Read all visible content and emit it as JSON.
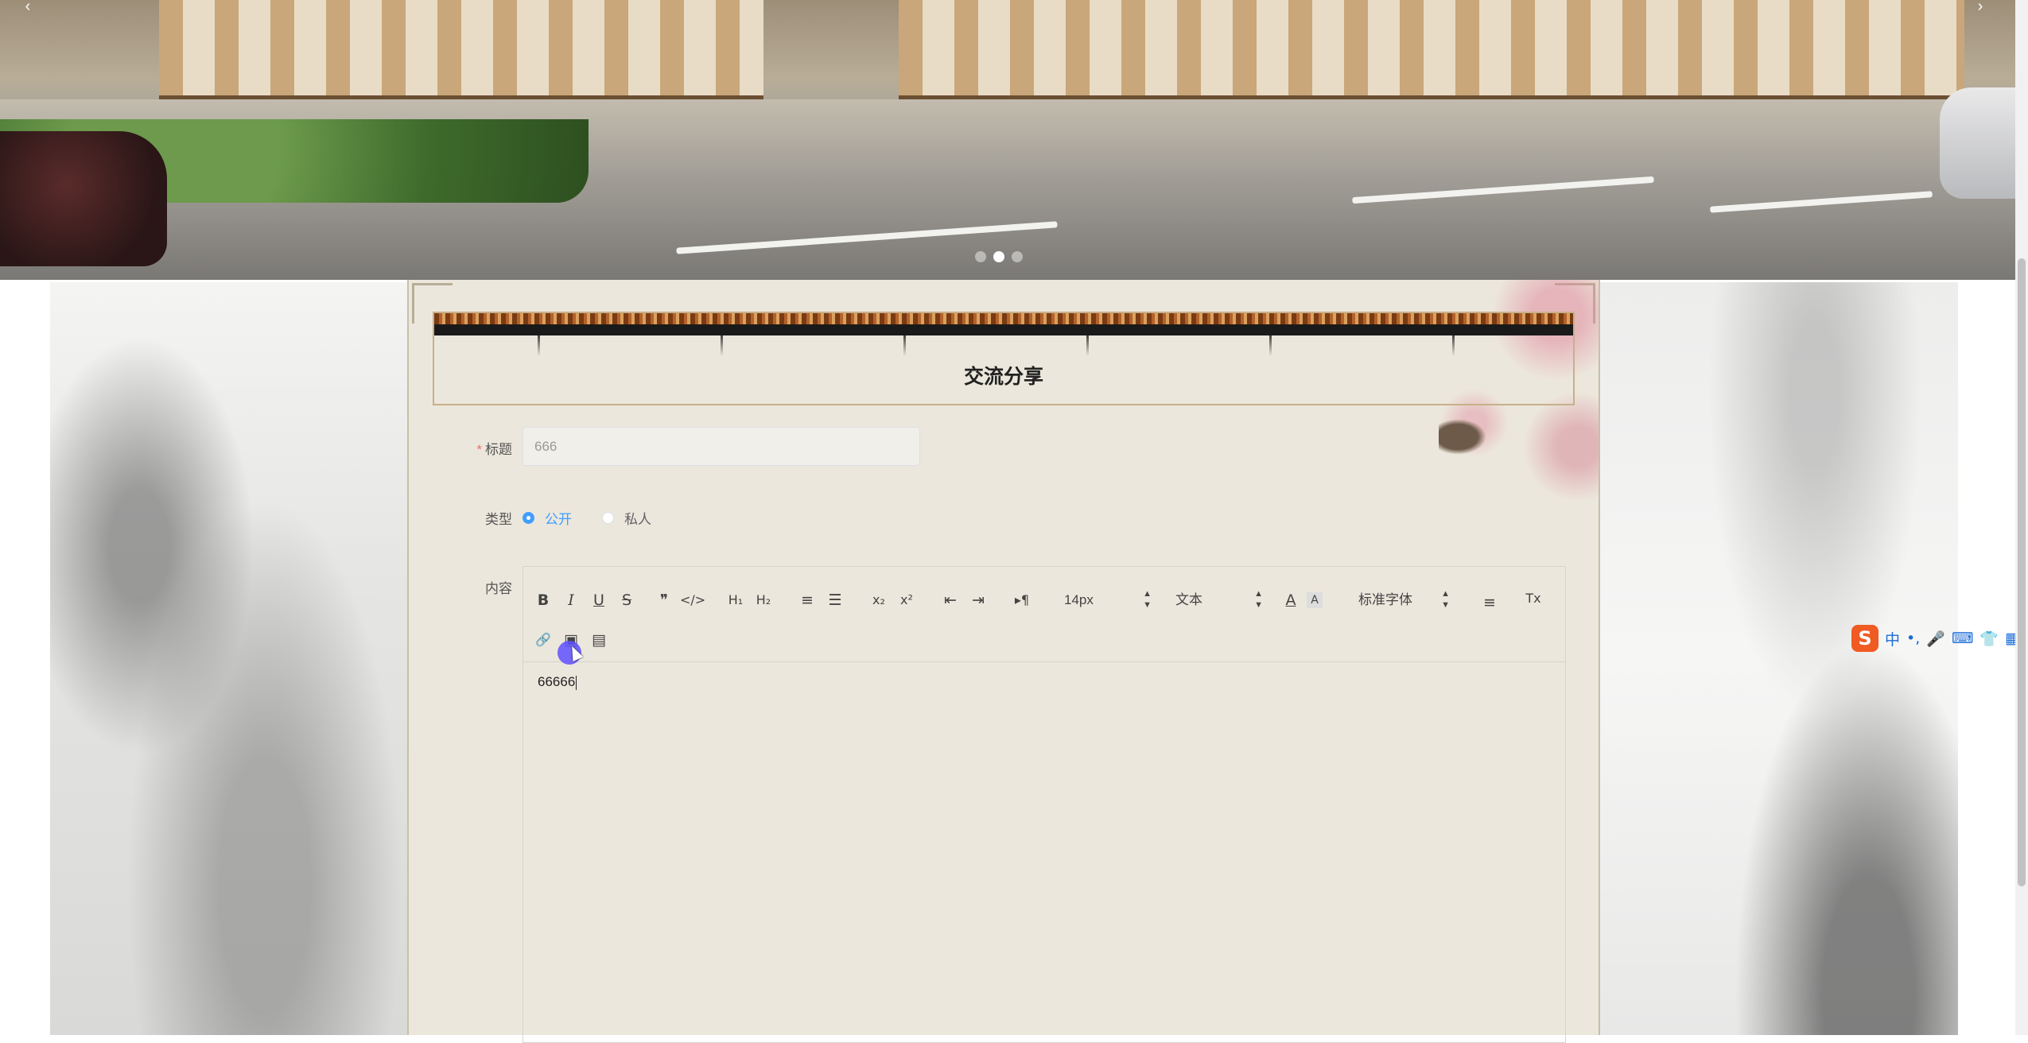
{
  "carousel": {
    "prev_arrow": "‹",
    "next_arrow": "›",
    "slide_count": 3,
    "active_slide": 2
  },
  "page": {
    "title": "交流分享"
  },
  "form": {
    "title_label": "标题",
    "title_required_mark": "*",
    "title_value": "666",
    "type_label": "类型",
    "type_options": [
      "公开",
      "私人"
    ],
    "type_selected": "公开",
    "content_label": "内容"
  },
  "editor": {
    "toolbar": {
      "bold": "B",
      "italic": "I",
      "underline": "U",
      "strike": "S",
      "blockquote": "❞",
      "code_block": "</>",
      "h1": "H₁",
      "h2": "H₂",
      "ordered_list": "≡",
      "bullet_list": "☰",
      "subscript": "x₂",
      "superscript": "x²",
      "outdent": "⇤",
      "indent": "⇥",
      "direction": "▸¶",
      "font_size": "14px",
      "header_picker": "文本",
      "font_color": "A",
      "background_color": "A",
      "font_family": "标准字体",
      "align": "≡",
      "clean": "Tx",
      "link": "🔗",
      "image": "▣",
      "video": "▤"
    },
    "content": "66666"
  },
  "ime": {
    "logo": "S",
    "items": [
      "中",
      "•,",
      "🎤",
      "⌨",
      "👕",
      "▦"
    ]
  },
  "colors": {
    "panel_bg": "#ece7dc",
    "accent": "#409eff",
    "required": "#f56c6c",
    "title_border": "#c7b08a"
  }
}
